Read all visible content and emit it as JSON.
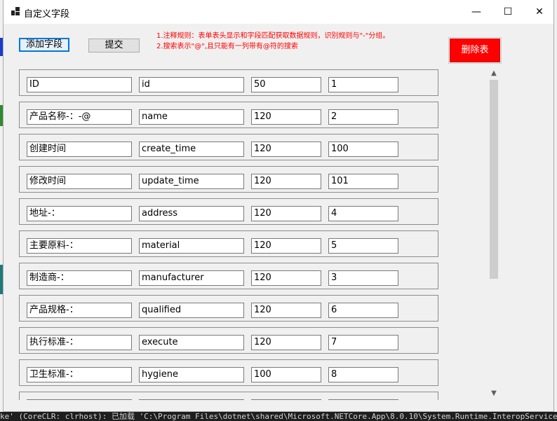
{
  "window": {
    "title": "自定义字段",
    "minimize_glyph": "—",
    "maximize_glyph": "☐",
    "close_glyph": "✕"
  },
  "toolbar": {
    "add_label": "添加字段",
    "submit_label": "提交",
    "delete_label": "删除表"
  },
  "notes": [
    "1.注释规则：表单表头显示和字段匹配获取数据规则，识别规则与\"-\"分组。",
    "2.搜索表示\"@\",且只能有一列带有@符的搜索"
  ],
  "fields": [
    {
      "label": "ID",
      "name": "id",
      "width": "50",
      "order": "1"
    },
    {
      "label": "产品名称-：-@",
      "name": "name",
      "width": "120",
      "order": "2"
    },
    {
      "label": "创建时间",
      "name": "create_time",
      "width": "120",
      "order": "100"
    },
    {
      "label": "修改时间",
      "name": "update_time",
      "width": "120",
      "order": "101"
    },
    {
      "label": "地址-：",
      "name": "address",
      "width": "120",
      "order": "4"
    },
    {
      "label": "主要原料-：",
      "name": "material",
      "width": "120",
      "order": "5"
    },
    {
      "label": "制造商-：",
      "name": "manufacturer",
      "width": "120",
      "order": "3"
    },
    {
      "label": "产品规格-：",
      "name": "qualified",
      "width": "120",
      "order": "6"
    },
    {
      "label": "执行标准-：",
      "name": "execute",
      "width": "120",
      "order": "7"
    },
    {
      "label": "卫生标准-：",
      "name": "hygiene",
      "width": "100",
      "order": "8"
    },
    {
      "label": "",
      "name": "",
      "width": "",
      "order": ""
    }
  ],
  "scrollbar": {
    "up_glyph": "▲",
    "down_glyph": "▼"
  },
  "console_text": "ke' (CoreCLR: clrhost): 已加载 'C:\\Program Files\\dotnet\\shared\\Microsoft.NETCore.App\\8.0.10\\System.Runtime.InteropServices.dll'. 已跳过加载"
}
